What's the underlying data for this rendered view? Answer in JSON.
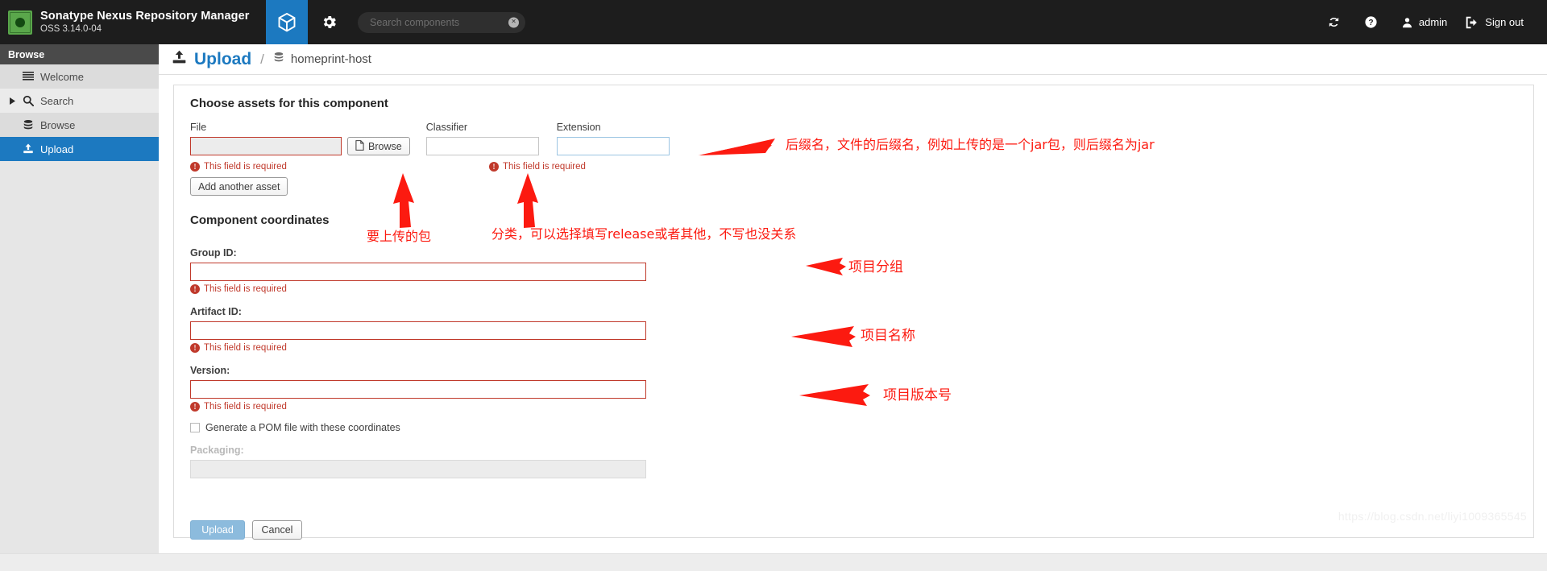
{
  "header": {
    "brand_title": "Sonatype Nexus Repository Manager",
    "brand_version": "OSS 3.14.0-04",
    "cube_icon": "cube-icon",
    "gear_icon": "gear-icon",
    "search": {
      "value": "",
      "placeholder": "Search components",
      "clear_glyph": "×"
    },
    "right_items": [
      {
        "icon": "refresh-icon",
        "label": ""
      },
      {
        "icon": "help-icon",
        "label": ""
      },
      {
        "icon": "user-icon",
        "label": "admin"
      },
      {
        "icon": "sign-out-icon",
        "label": "Sign out"
      }
    ]
  },
  "sidebar": {
    "header": "Browse",
    "items": [
      {
        "label": "Welcome",
        "icon": "welcome-lines-icon",
        "caret": false,
        "active": false
      },
      {
        "label": "Search",
        "icon": "search-icon",
        "caret": true,
        "active": false
      },
      {
        "label": "Browse",
        "icon": "database-icon",
        "caret": false,
        "active": false
      },
      {
        "label": "Upload",
        "icon": "upload-icon",
        "caret": false,
        "active": true
      }
    ]
  },
  "page": {
    "title": "Upload",
    "title_icon": "upload-icon",
    "separator": "/",
    "breadcrumb_icon": "database-icon",
    "breadcrumb": "homeprint-host"
  },
  "form": {
    "assets_heading": "Choose assets for this component",
    "file_label": "File",
    "file_value": "",
    "file_error": "This field is required",
    "browse_label": "Browse",
    "browse_icon": "file-icon",
    "classifier_label": "Classifier",
    "classifier_value": "",
    "extension_label": "Extension",
    "extension_value": "",
    "extension_error": "This field is required",
    "add_asset_label": "Add another asset",
    "coordinates_heading": "Component coordinates",
    "group_id_label": "Group ID:",
    "group_id_value": "",
    "group_id_error": "This field is required",
    "artifact_id_label": "Artifact ID:",
    "artifact_id_value": "",
    "artifact_id_error": "This field is required",
    "version_label": "Version:",
    "version_value": "",
    "version_error": "This field is required",
    "pom_checkbox_label": "Generate a POM file with these coordinates",
    "pom_checked": false,
    "packaging_label": "Packaging:",
    "packaging_value": "",
    "upload_button": "Upload",
    "cancel_button": "Cancel"
  },
  "annotations": [
    {
      "id": "ext-note",
      "text": "后缀名，文件的后缀名，例如上传的是一个jar包，则后缀名为jar"
    },
    {
      "id": "file-note",
      "text": "要上传的包"
    },
    {
      "id": "classifier-note",
      "text": "分类，可以选择填写release或者其他，不写也没关系"
    },
    {
      "id": "group-note",
      "text": "项目分组"
    },
    {
      "id": "artifact-note",
      "text": "项目名称"
    },
    {
      "id": "version-note",
      "text": "项目版本号"
    }
  ],
  "watermark": "https://blog.csdn.net/liyi1009365545",
  "colors": {
    "accent_blue": "#1c79c0",
    "error_red": "#c0392b",
    "annotation_red": "#fc1a10",
    "header_bg": "#1d1d1d",
    "sidebar_bg": "#e6e6e6"
  }
}
